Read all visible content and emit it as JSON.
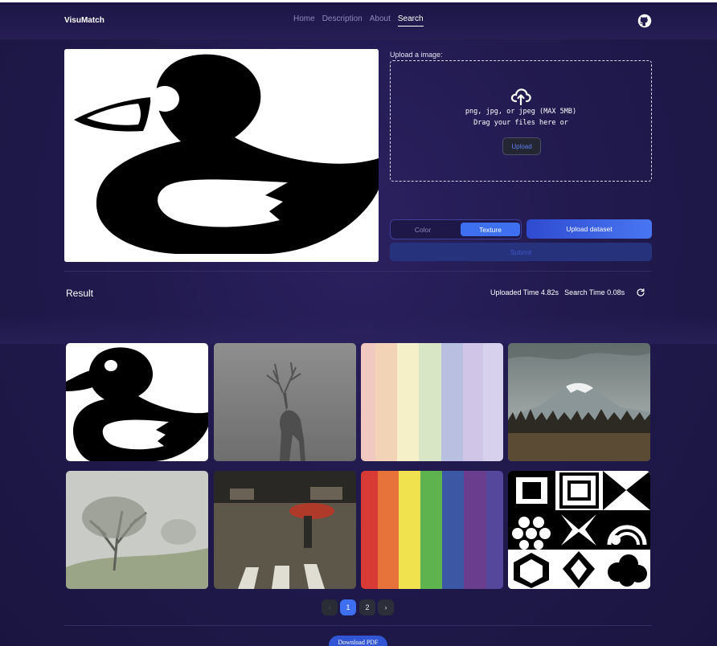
{
  "app": {
    "brand": "VisuMatch"
  },
  "nav": {
    "links": [
      "Home",
      "Description",
      "About",
      "Search"
    ],
    "active": "Search",
    "github_icon": "github-icon"
  },
  "upload": {
    "label": "Upload a image:",
    "hint_line1": "png, jpg, or jpeg (MAX 5MB)",
    "hint_line2": "Drag your files here or",
    "button": "Upload",
    "icon": "cloud-upload-icon"
  },
  "query_image": {
    "subject": "black-duck-silhouette"
  },
  "modes": {
    "color": "Color",
    "texture": "Texture",
    "selected": "Texture"
  },
  "actions": {
    "dataset": "Upload dataset",
    "submit": "Submit",
    "download_pdf": "Download PDF"
  },
  "result": {
    "title": "Result",
    "uploaded_time": "Uploaded Time 4.82s",
    "search_time": "Search Time 0.08s",
    "refresh_icon": "refresh-icon"
  },
  "results": [
    {
      "subject": "black duck silhouette"
    },
    {
      "subject": "deer in fog"
    },
    {
      "subject": "pastel color stripes"
    },
    {
      "subject": "snowy mountain over forest"
    },
    {
      "subject": "tree in foggy field"
    },
    {
      "subject": "person with umbrella on rainy crosswalk"
    },
    {
      "subject": "rainbow color stripes"
    },
    {
      "subject": "black and white geometric pattern tiles"
    }
  ],
  "pagination": {
    "prev": "‹",
    "pages": [
      "1",
      "2"
    ],
    "current": "1",
    "next": "›"
  },
  "colors": {
    "accent": "#3d6ff0",
    "background": "#211a4e",
    "rainbow": [
      "#d83a35",
      "#e8733a",
      "#efe24e",
      "#5fb34f",
      "#3c58a4",
      "#6b3d8f",
      "#54479c"
    ],
    "pastel": [
      "#f1c9c1",
      "#f3d3b6",
      "#f6f0c8",
      "#d8e6c6",
      "#b9bfe0",
      "#d0c5e6",
      "#d8d1ee"
    ]
  }
}
